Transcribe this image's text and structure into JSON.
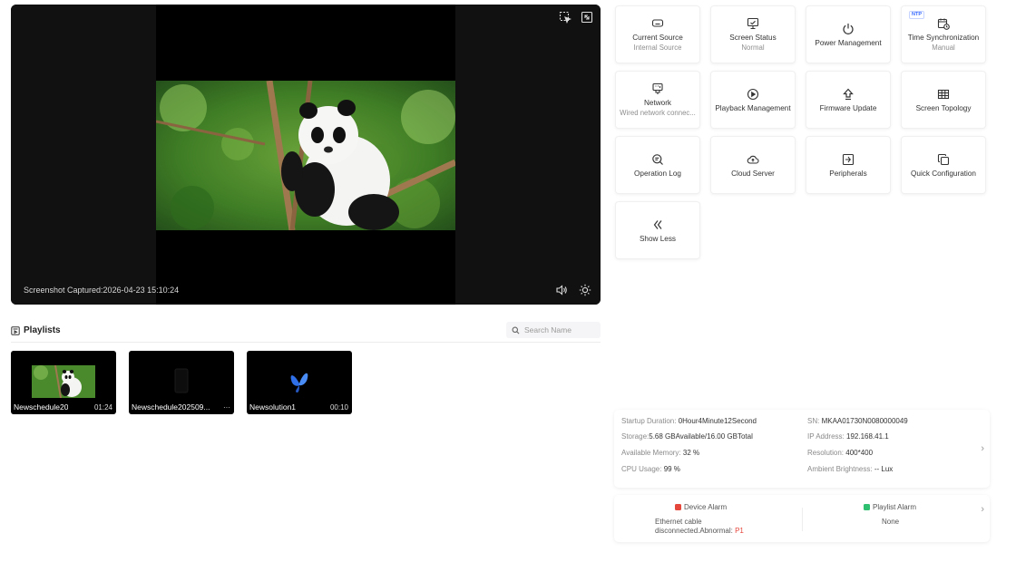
{
  "preview": {
    "caption": "Screenshot Captured:2026-04-23 15:10:24",
    "icons": [
      "select-area-icon",
      "fullscreen-icon",
      "volume-icon",
      "brightness-icon"
    ]
  },
  "playlists": {
    "title": "Playlists",
    "search_placeholder": "Search Name",
    "items": [
      {
        "name": "Newschedule20",
        "duration": "01:24",
        "thumb": "panda"
      },
      {
        "name": "Newschedule202509...",
        "duration": "···",
        "thumb": "dark"
      },
      {
        "name": "Newsolution1",
        "duration": "00:10",
        "thumb": "butterfly"
      }
    ]
  },
  "tiles": [
    {
      "id": "current-source",
      "label": "Current Source",
      "sub": "Internal Source",
      "icon": "source-icon"
    },
    {
      "id": "screen-status",
      "label": "Screen Status",
      "sub": "Normal",
      "icon": "monitor-icon"
    },
    {
      "id": "power-management",
      "label": "Power Management",
      "sub": "",
      "icon": "power-icon"
    },
    {
      "id": "time-sync",
      "label": "Time Synchronization",
      "sub": "Manual",
      "icon": "calendar-clock-icon",
      "badge": "NTP"
    },
    {
      "id": "network",
      "label": "Network",
      "sub": "Wired network connec...",
      "icon": "network-icon"
    },
    {
      "id": "playback-management",
      "label": "Playback Management",
      "sub": "",
      "icon": "play-circle-icon"
    },
    {
      "id": "firmware-update",
      "label": "Firmware Update",
      "sub": "",
      "icon": "upload-arrow-icon"
    },
    {
      "id": "screen-topology",
      "label": "Screen Topology",
      "sub": "",
      "icon": "grid-icon"
    },
    {
      "id": "operation-log",
      "label": "Operation Log",
      "sub": "",
      "icon": "log-search-icon"
    },
    {
      "id": "cloud-server",
      "label": "Cloud Server",
      "sub": "",
      "icon": "cloud-icon"
    },
    {
      "id": "peripherals",
      "label": "Peripherals",
      "sub": "",
      "icon": "peripherals-icon"
    },
    {
      "id": "quick-configuration",
      "label": "Quick Configuration",
      "sub": "",
      "icon": "copy-icon"
    },
    {
      "id": "show-less",
      "label": "Show Less",
      "sub": "",
      "icon": "double-chevron-left-icon"
    }
  ],
  "info": {
    "startup_label": "Startup Duration: ",
    "startup_value": "0Hour4Minute12Second",
    "storage_label": "Storage:",
    "storage_value": "5.68 GBAvailable/16.00 GBTotal",
    "memory_label": "Available Memory: ",
    "memory_value": "32 %",
    "cpu_label": "CPU Usage: ",
    "cpu_value": "99 %",
    "sn_label": "SN: ",
    "sn_value": "MKAA01730N0080000049",
    "ip_label": "IP Address: ",
    "ip_value": "192.168.41.1",
    "resolution_label": "Resolution: ",
    "resolution_value": "400*400",
    "brightness_label": "Ambient Brightness: ",
    "brightness_value": "-- Lux"
  },
  "alarm": {
    "device_title": "Device Alarm",
    "device_text_1": "Ethernet cable",
    "device_text_2": "disconnected.Abnormal: ",
    "device_level": "P1",
    "device_color": "#e5473c",
    "playlist_title": "Playlist Alarm",
    "playlist_text": "None",
    "playlist_color": "#2fbf71"
  },
  "colors": {
    "accent": "#3366ff",
    "alert": "#e5473c",
    "ok": "#2fbf71"
  }
}
